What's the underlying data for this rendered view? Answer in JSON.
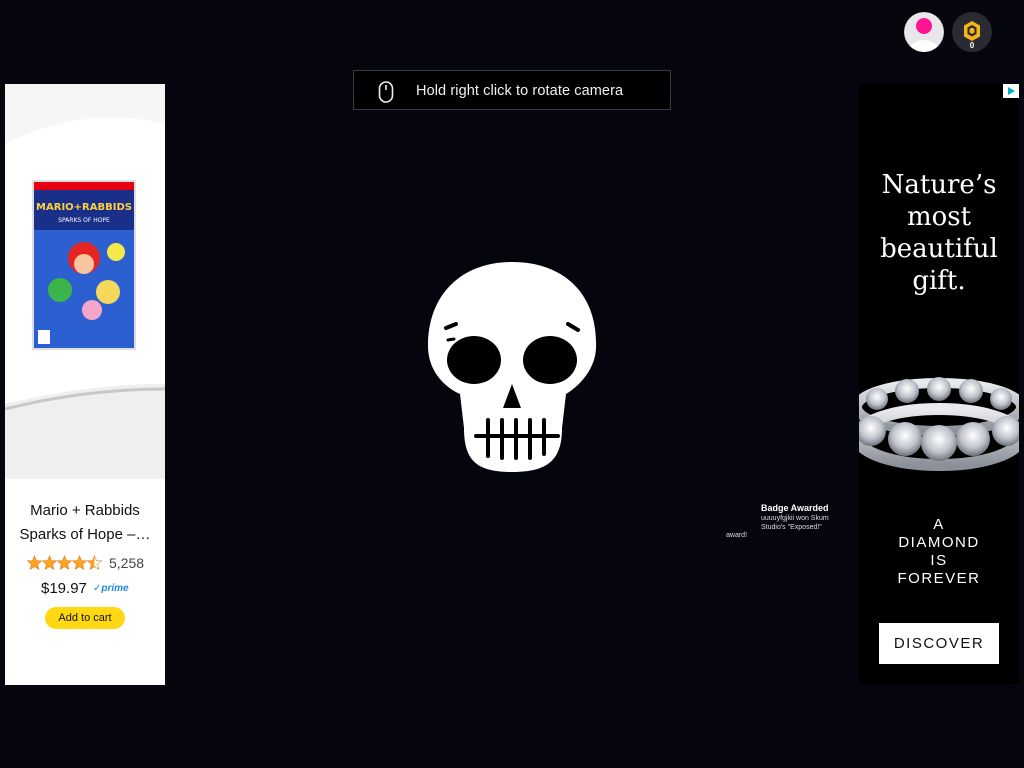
{
  "camera_hint": {
    "text": "Hold right click to rotate camera",
    "icon": "mouse-icon"
  },
  "top_bar": {
    "avatar_icon": "avatar-icon",
    "coin_icon": "coin-icon",
    "coin_count": "0",
    "accent": "#ff1493"
  },
  "ad_left": {
    "close_label": "×",
    "product_image": "game-box-art",
    "product_title_line1": "Mario + Rabbids",
    "product_title_line2": "Sparks of Hope –…",
    "rating_stars": 4.5,
    "rating_count": "5,258",
    "price": "$19.97",
    "prime_label": "✓prime",
    "cart_label": "Add to cart"
  },
  "ad_right": {
    "headline_lines": [
      "Nature’s",
      "most",
      "beautiful",
      "gift."
    ],
    "slogan_lines": [
      "A",
      "DIAMOND",
      "IS",
      "FOREVER"
    ],
    "cta_label": "DISCOVER"
  },
  "skull": {
    "icon": "skull-icon"
  },
  "badge_notice": {
    "title": "Badge Awarded",
    "message": "uuuuyfgjkii won Skum Studio's \"Exposed!\"",
    "tail": "award!"
  }
}
